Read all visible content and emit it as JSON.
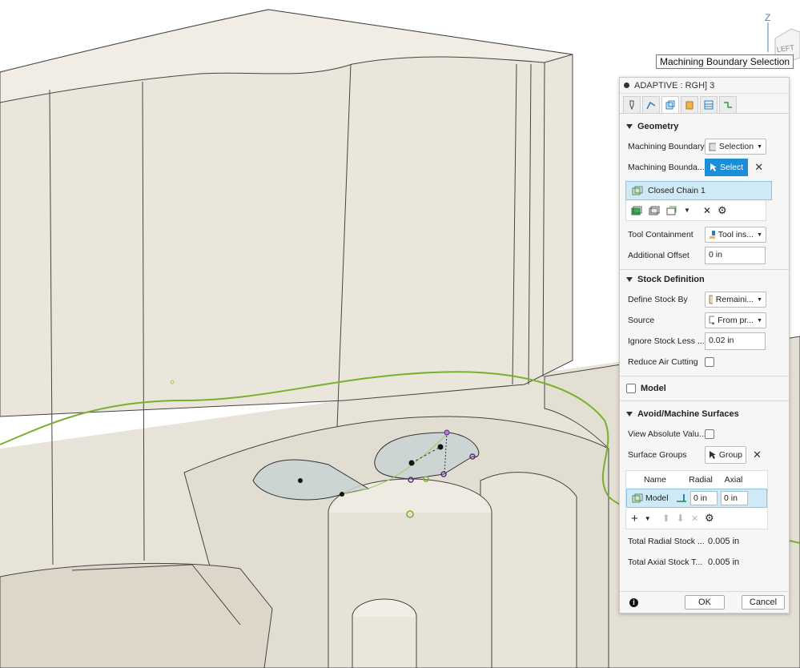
{
  "viewcube": {
    "axis_label": "Z",
    "face_label": "LEFT"
  },
  "tooltip": {
    "text": "Machining Boundary Selection"
  },
  "panel": {
    "title": "ADAPTIVE : RGH] 3",
    "tabs": [
      "tool-tab-icon",
      "tool-path-tab-icon",
      "geometry-tab-icon",
      "heights-tab-icon",
      "passes-tab-icon",
      "linking-tab-icon"
    ],
    "geometry": {
      "header": "Geometry",
      "machining_boundary_label": "Machining Boundary",
      "machining_boundary_value": "Selection",
      "boundary_selection_label": "Machining Bounda...",
      "select_label": "Select",
      "chain_item": "Closed Chain 1",
      "tool_containment_label": "Tool Containment",
      "tool_containment_value": "Tool ins...",
      "additional_offset_label": "Additional Offset",
      "additional_offset_value": "0 in"
    },
    "stock": {
      "header": "Stock Definition",
      "define_stock_label": "Define Stock By",
      "define_stock_value": "Remaini...",
      "source_label": "Source",
      "source_value": "From pr...",
      "ignore_stock_label": "Ignore Stock Less ...",
      "ignore_stock_value": "0.02 in",
      "reduce_air_label": "Reduce Air Cutting"
    },
    "model": {
      "header": "Model"
    },
    "avoid": {
      "header": "Avoid/Machine Surfaces",
      "view_absolute_label": "View Absolute Valu...",
      "surface_groups_label": "Surface Groups",
      "group_label": "Group",
      "col_name": "Name",
      "col_radial": "Radial",
      "col_axial": "Axial",
      "row_name": "Model",
      "row_radial": "0 in",
      "row_axial": "0 in",
      "total_radial_label": "Total Radial Stock ...",
      "total_radial_value": "0.005 in",
      "total_axial_label": "Total Axial Stock T...",
      "total_axial_value": "0.005 in"
    },
    "footer": {
      "info": "i",
      "ok": "OK",
      "cancel": "Cancel"
    }
  },
  "colors": {
    "select_blue": "#1a8fd8",
    "selection_row": "#cfe9f6",
    "boundary_green": "#79b02c",
    "model_surface": "#ece8de"
  }
}
